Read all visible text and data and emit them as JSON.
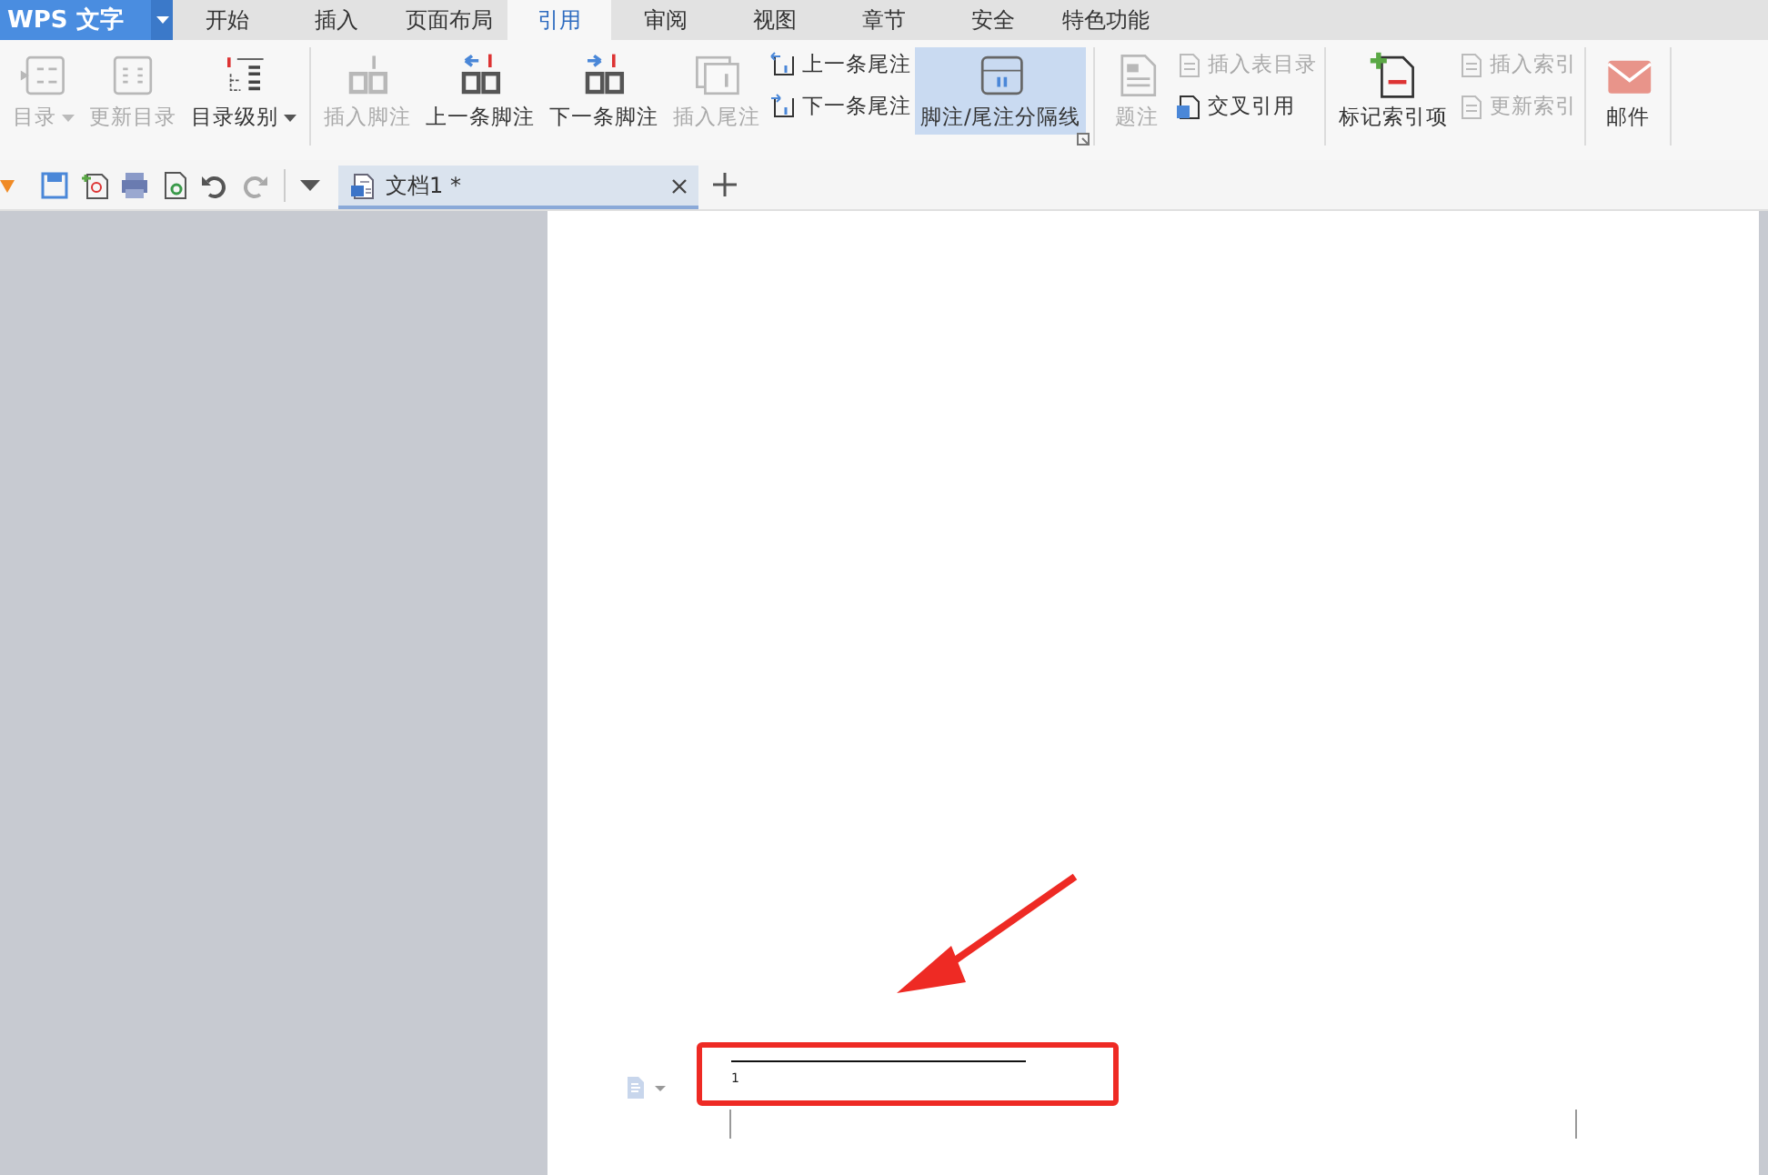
{
  "app": {
    "title": "WPS 文字"
  },
  "tabs": [
    {
      "label": "开始",
      "selected": false
    },
    {
      "label": "插入",
      "selected": false
    },
    {
      "label": "页面布局",
      "selected": false
    },
    {
      "label": "引用",
      "selected": true
    },
    {
      "label": "审阅",
      "selected": false
    },
    {
      "label": "视图",
      "selected": false
    },
    {
      "label": "章节",
      "selected": false
    },
    {
      "label": "安全",
      "selected": false
    },
    {
      "label": "特色功能",
      "selected": false
    }
  ],
  "ribbon": [
    {
      "items": [
        {
          "kind": "big",
          "label": "目录",
          "disabled": true,
          "dropdown": true,
          "selected": false
        },
        {
          "kind": "big",
          "label": "更新目录",
          "disabled": true,
          "dropdown": false,
          "selected": false
        },
        {
          "kind": "big",
          "label": "目录级别",
          "disabled": false,
          "dropdown": true,
          "selected": false
        }
      ]
    },
    {
      "launcher": true,
      "items": [
        {
          "kind": "big",
          "label": "插入脚注",
          "disabled": true,
          "dropdown": false,
          "selected": false
        },
        {
          "kind": "big",
          "label": "上一条脚注",
          "disabled": false,
          "dropdown": false,
          "selected": false
        },
        {
          "kind": "big",
          "label": "下一条脚注",
          "disabled": false,
          "dropdown": false,
          "selected": false
        },
        {
          "kind": "big",
          "label": "插入尾注",
          "disabled": true,
          "dropdown": false,
          "selected": false
        },
        {
          "kind": "stack",
          "rows": [
            {
              "label": "上一条尾注",
              "disabled": false
            },
            {
              "label": "下一条尾注",
              "disabled": false
            }
          ]
        },
        {
          "kind": "big",
          "label": "脚注/尾注分隔线",
          "disabled": false,
          "dropdown": false,
          "selected": true
        }
      ]
    },
    {
      "items": [
        {
          "kind": "big",
          "label": "题注",
          "disabled": true,
          "dropdown": false,
          "selected": false
        },
        {
          "kind": "stack",
          "rows": [
            {
              "label": "插入表目录",
              "disabled": true
            },
            {
              "label": "交叉引用",
              "disabled": false
            }
          ]
        }
      ]
    },
    {
      "items": [
        {
          "kind": "big",
          "label": "标记索引项",
          "disabled": false,
          "dropdown": false,
          "selected": false
        },
        {
          "kind": "stack",
          "rows": [
            {
              "label": "插入索引",
              "disabled": true
            },
            {
              "label": "更新索引",
              "disabled": true
            }
          ]
        }
      ]
    },
    {
      "items": [
        {
          "kind": "big",
          "label": "邮件",
          "disabled": false,
          "dropdown": false,
          "selected": false
        }
      ]
    }
  ],
  "documents": [
    {
      "title": "文档1 *",
      "selected": true
    }
  ],
  "footnote": {
    "mark": "1"
  }
}
